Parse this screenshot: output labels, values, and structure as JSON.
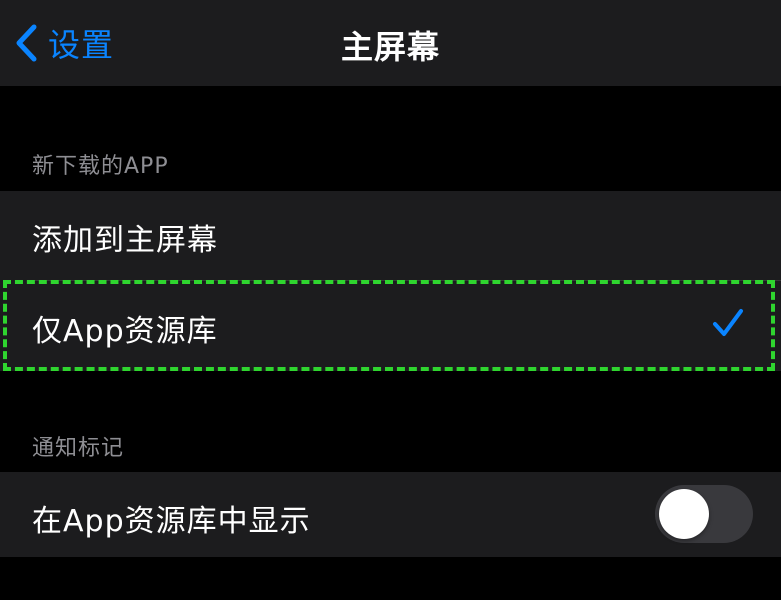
{
  "nav": {
    "back_label": "设置",
    "title": "主屏幕"
  },
  "sections": {
    "new_downloads": {
      "header": "新下载的APP",
      "options": [
        {
          "label": "添加到主屏幕",
          "selected": false
        },
        {
          "label": "仅App资源库",
          "selected": true
        }
      ]
    },
    "badges": {
      "header": "通知标记",
      "show_in_library_label": "在App资源库中显示",
      "show_in_library_enabled": false
    }
  },
  "colors": {
    "accent": "#0a84ff",
    "highlight": "#2fd52f",
    "cell_background": "#1c1c1e",
    "page_background": "#000000"
  },
  "icons": {
    "back": "chevron-left-icon",
    "selected": "checkmark-icon"
  }
}
